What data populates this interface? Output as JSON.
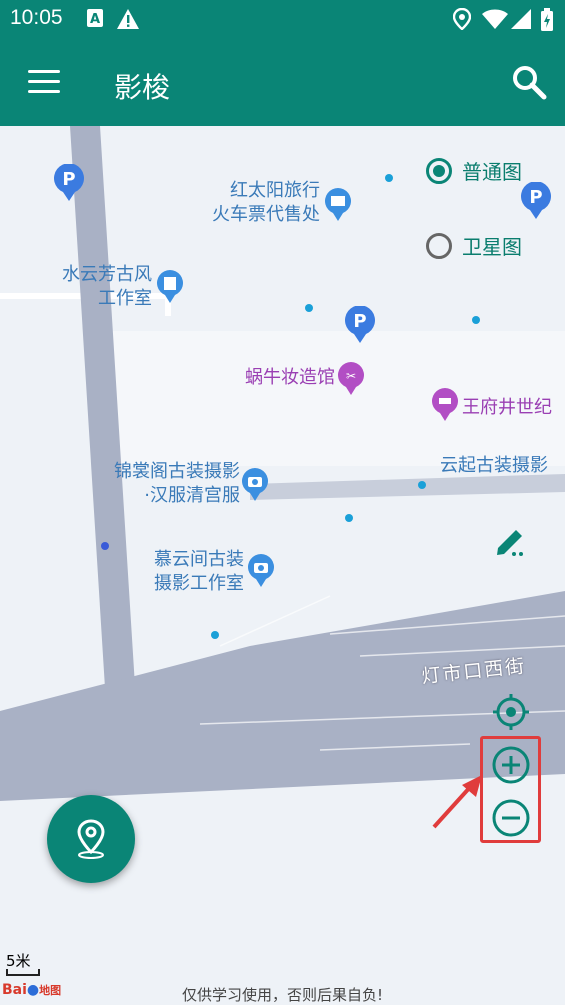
{
  "status_bar": {
    "time": "10:05"
  },
  "app_bar": {
    "title": "影梭"
  },
  "map_type": {
    "normal": "普通图",
    "satellite": "卫星图",
    "selected": "普通图"
  },
  "pois": {
    "railway_ticket_line1": "红太阳旅行",
    "railway_ticket_line2": "火车票代售处",
    "shuiyun_line1": "水云芳古风",
    "shuiyun_line2": "工作室",
    "woniu": "蜗牛妆造馆",
    "wangfujing": "王府井世纪",
    "jinshang_line1": "锦裳阁古装摄影",
    "jinshang_line2": "·汉服清宫服",
    "yunqi": "云起古装摄影",
    "muyun_line1": "慕云间古装",
    "muyun_line2": "摄影工作室",
    "street": "灯市口西街"
  },
  "scale_label": "5米",
  "disclaimer": "仅供学习使用，否则后果自负!",
  "baidu_logo": {
    "text1": "Bai",
    "text2": "地图"
  },
  "colors": {
    "primary": "#0a8576",
    "highlight_box": "#e03c3c",
    "road": "#a9b1c5"
  }
}
